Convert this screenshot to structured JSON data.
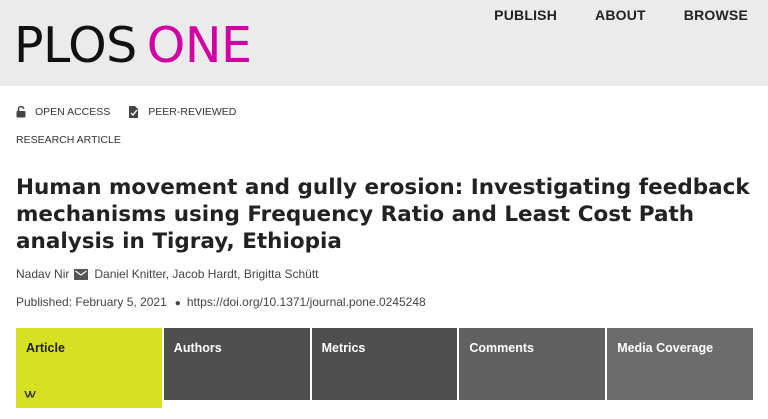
{
  "header": {
    "logo_part1": "PLOS",
    "logo_part2": "ONE",
    "nav": [
      "PUBLISH",
      "ABOUT",
      "BROWSE"
    ]
  },
  "badges": {
    "open_access": "OPEN ACCESS",
    "peer_reviewed": "PEER-REVIEWED"
  },
  "article_type": "RESEARCH ARTICLE",
  "title": "Human movement and gully erosion: Investigating feedback mechanisms using Frequency Ratio and Least Cost Path analysis in Tigray, Ethiopia",
  "authors": [
    "Nadav Nir",
    "Daniel Knitter,",
    "Jacob Hardt,",
    "Brigitta Schütt"
  ],
  "published": {
    "date_text": "Published: February 5, 2021",
    "doi": "https://doi.org/10.1371/journal.pone.0245248"
  },
  "tabs": [
    "Article",
    "Authors",
    "Metrics",
    "Comments",
    "Media Coverage"
  ],
  "icons": {
    "open_access": "unlocked-padlock-icon",
    "peer_reviewed": "peer-reviewed-icon",
    "email": "envelope-icon",
    "chevron": "double-chevron-down-icon"
  },
  "colors": {
    "brand_magenta": "#d100a2",
    "active_tab": "#d7e022",
    "tab_bg": "#555555",
    "header_bg": "#ebebeb"
  }
}
